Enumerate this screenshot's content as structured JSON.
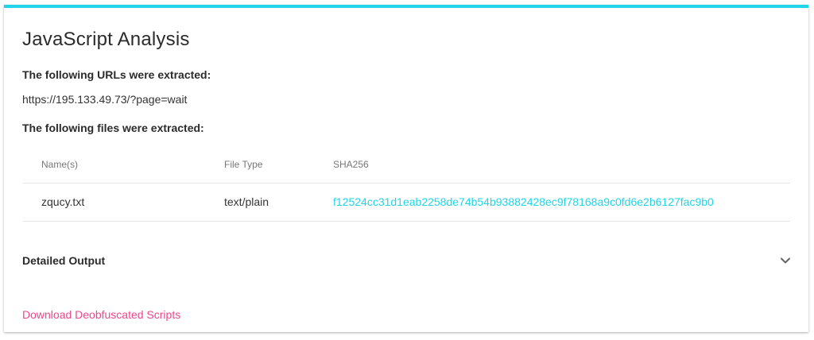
{
  "panel": {
    "title": "JavaScript Analysis",
    "urls_heading": "The following URLs were extracted:",
    "urls": [
      "https://195.133.49.73/?page=wait"
    ],
    "files_heading": "The following files were extracted:"
  },
  "files_table": {
    "columns": [
      "Name(s)",
      "File Type",
      "SHA256"
    ],
    "rows": [
      {
        "name": "zqucy.txt",
        "type": "text/plain",
        "sha256": "f12524cc31d1eab2258de74b54b93882428ec9f78168a9c0fd6e2b6127fac9b0"
      }
    ]
  },
  "detailed_output": {
    "label": "Detailed Output",
    "icon": "chevron-down-icon"
  },
  "download_link": "Download Deobfuscated Scripts",
  "colors": {
    "accent": "#1fd5e6",
    "link_pink": "#f0468a"
  }
}
